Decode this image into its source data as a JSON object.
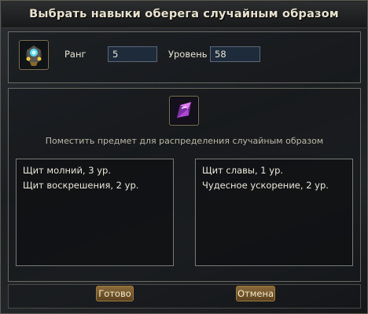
{
  "window": {
    "title": "Выбрать навыки оберега случайным образом"
  },
  "info": {
    "rank_label": "Ранг",
    "rank_value": "5",
    "level_label": "Уровень",
    "level_value": "58"
  },
  "icons": {
    "amulet": "amulet-icon",
    "item": "crystal-icon"
  },
  "hint": "Поместить предмет для распределения случайным образом",
  "lists": {
    "left": [
      "Щит молний, 3 ур.",
      "Щит воскрешения, 2 ур."
    ],
    "right": [
      "Щит славы, 1 ур.",
      "Чудесное ускорение, 2 ур."
    ]
  },
  "buttons": {
    "ok": "Готово",
    "cancel": "Отмена"
  },
  "colors": {
    "accent": "#a07a3a",
    "field_bg": "#1d2b3b"
  }
}
